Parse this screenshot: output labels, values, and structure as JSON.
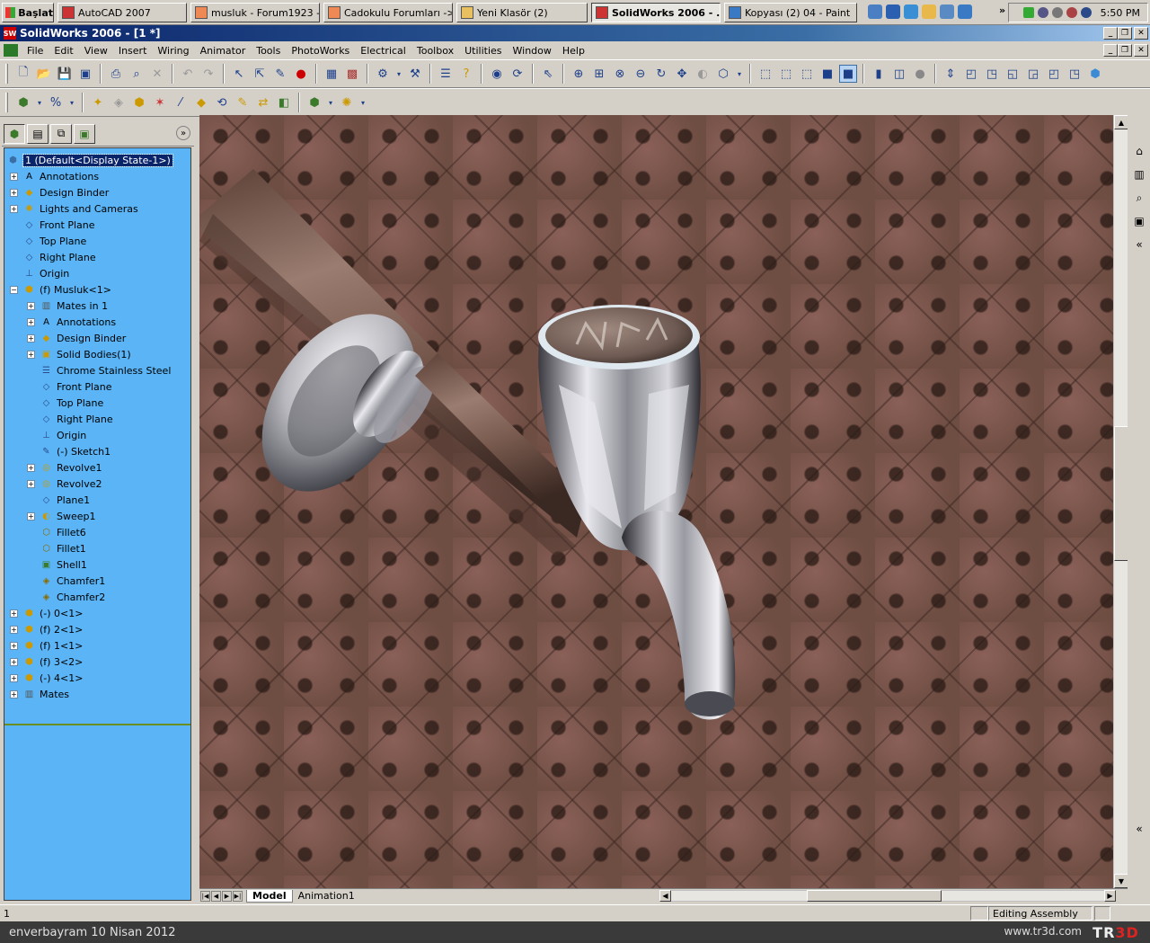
{
  "taskbar": {
    "start_label": "Başlat",
    "tasks": [
      {
        "label": "AutoCAD 2007",
        "active": false
      },
      {
        "label": "musluk - Forum1923 -...",
        "active": false
      },
      {
        "label": "Cadokulu Forumları ->...",
        "active": false
      },
      {
        "label": "Yeni Klasör (2)",
        "active": false
      },
      {
        "label": "SolidWorks 2006 - ...",
        "active": true
      },
      {
        "label": "Kopyası (2) 04 - Paint",
        "active": false
      }
    ],
    "clock": "5:50 PM",
    "more_label": "»"
  },
  "window": {
    "title": "SolidWorks 2006 - [1 *]"
  },
  "menu": {
    "items": [
      "File",
      "Edit",
      "View",
      "Insert",
      "Wiring",
      "Animator",
      "Tools",
      "PhotoWorks",
      "Electrical",
      "Toolbox",
      "Utilities",
      "Window",
      "Help"
    ]
  },
  "feature_tree": {
    "items": [
      {
        "label": "1  (Default<Display State-1>)",
        "level": 0,
        "expander": "",
        "icon": "assembly-icon",
        "highlight": true
      },
      {
        "label": "Annotations",
        "level": 1,
        "expander": "+",
        "icon": "annotations-icon"
      },
      {
        "label": "Design Binder",
        "level": 1,
        "expander": "+",
        "icon": "design-binder-icon"
      },
      {
        "label": "Lights and Cameras",
        "level": 1,
        "expander": "+",
        "icon": "lights-icon"
      },
      {
        "label": "Front Plane",
        "level": 1,
        "expander": "",
        "icon": "plane-icon"
      },
      {
        "label": "Top Plane",
        "level": 1,
        "expander": "",
        "icon": "plane-icon"
      },
      {
        "label": "Right Plane",
        "level": 1,
        "expander": "",
        "icon": "plane-icon"
      },
      {
        "label": "Origin",
        "level": 1,
        "expander": "",
        "icon": "origin-icon"
      },
      {
        "label": "(f) Musluk<1>",
        "level": 1,
        "expander": "−",
        "icon": "part-icon"
      },
      {
        "label": "Mates in 1",
        "level": 2,
        "expander": "+",
        "icon": "mates-icon"
      },
      {
        "label": "Annotations",
        "level": 2,
        "expander": "+",
        "icon": "annotations-icon"
      },
      {
        "label": "Design Binder",
        "level": 2,
        "expander": "+",
        "icon": "design-binder-icon"
      },
      {
        "label": "Solid Bodies(1)",
        "level": 2,
        "expander": "+",
        "icon": "solid-bodies-icon"
      },
      {
        "label": "Chrome Stainless Steel",
        "level": 2,
        "expander": "",
        "icon": "material-icon"
      },
      {
        "label": "Front Plane",
        "level": 2,
        "expander": "",
        "icon": "plane-icon"
      },
      {
        "label": "Top Plane",
        "level": 2,
        "expander": "",
        "icon": "plane-icon"
      },
      {
        "label": "Right Plane",
        "level": 2,
        "expander": "",
        "icon": "plane-icon"
      },
      {
        "label": "Origin",
        "level": 2,
        "expander": "",
        "icon": "origin-icon"
      },
      {
        "label": "(-) Sketch1",
        "level": 2,
        "expander": "",
        "icon": "sketch-icon"
      },
      {
        "label": "Revolve1",
        "level": 2,
        "expander": "+",
        "icon": "revolve-icon"
      },
      {
        "label": "Revolve2",
        "level": 2,
        "expander": "+",
        "icon": "revolve-icon"
      },
      {
        "label": "Plane1",
        "level": 2,
        "expander": "",
        "icon": "plane-icon"
      },
      {
        "label": "Sweep1",
        "level": 2,
        "expander": "+",
        "icon": "sweep-icon"
      },
      {
        "label": "Fillet6",
        "level": 2,
        "expander": "",
        "icon": "fillet-icon"
      },
      {
        "label": "Fillet1",
        "level": 2,
        "expander": "",
        "icon": "fillet-icon"
      },
      {
        "label": "Shell1",
        "level": 2,
        "expander": "",
        "icon": "shell-icon"
      },
      {
        "label": "Chamfer1",
        "level": 2,
        "expander": "",
        "icon": "chamfer-icon"
      },
      {
        "label": "Chamfer2",
        "level": 2,
        "expander": "",
        "icon": "chamfer-icon"
      },
      {
        "label": "(-) 0<1>",
        "level": 1,
        "expander": "+",
        "icon": "part-icon"
      },
      {
        "label": "(f) 2<1>",
        "level": 1,
        "expander": "+",
        "icon": "part-icon"
      },
      {
        "label": "(f) 1<1>",
        "level": 1,
        "expander": "+",
        "icon": "part-icon"
      },
      {
        "label": "(f) 3<2>",
        "level": 1,
        "expander": "+",
        "icon": "part-icon"
      },
      {
        "label": "(-) 4<1>",
        "level": 1,
        "expander": "+",
        "icon": "part-icon"
      },
      {
        "label": "Mates",
        "level": 1,
        "expander": "+",
        "icon": "mates-icon"
      }
    ]
  },
  "bottom_tabs": {
    "tabs": [
      {
        "label": "Model",
        "selected": true
      },
      {
        "label": "Animation1",
        "selected": false
      }
    ]
  },
  "status": {
    "left": "1",
    "mode": "Editing Assembly"
  },
  "watermark": {
    "left": "enverbayram 10 Nisan 2012",
    "site": "www.tr3d.com",
    "logo_a": "TR",
    "logo_b": "3D"
  },
  "colors": {
    "tree_bg": "#5ab4f5",
    "title_bar": "#0a246a",
    "tile": "#6e4d42"
  }
}
